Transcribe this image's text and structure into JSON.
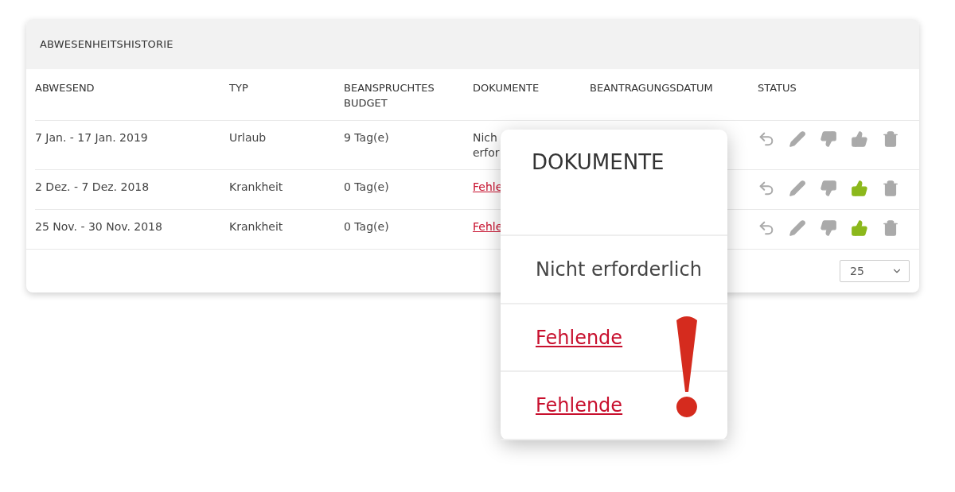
{
  "panel": {
    "title": "ABWESENHEITSHISTORIE",
    "columns": [
      {
        "label": "ABWESEND"
      },
      {
        "label": "TYP"
      },
      {
        "label": "BEANSPRUCHTES BUDGET"
      },
      {
        "label": "DOKUMENTE"
      },
      {
        "label": "BEANTRAGUNGSDATUM"
      },
      {
        "label": "STATUS"
      }
    ],
    "rows": [
      {
        "absent": "7 Jan. - 17 Jan. 2019",
        "type": "Urlaub",
        "budget": "9 Tag(e)",
        "documents": {
          "kind": "text",
          "lines": [
            "Nich",
            "erfor"
          ]
        },
        "approved": false
      },
      {
        "absent": "2 Dez. - 7 Dez. 2018",
        "type": "Krankheit",
        "budget": "0 Tag(e)",
        "documents": {
          "kind": "link",
          "lines": [
            "Fehle"
          ]
        },
        "approved": true
      },
      {
        "absent": "25 Nov. - 30 Nov. 2018",
        "type": "Krankheit",
        "budget": "0 Tag(e)",
        "documents": {
          "kind": "link",
          "lines": [
            "Fehle"
          ]
        },
        "approved": true
      }
    ],
    "page_size": "25"
  },
  "popup": {
    "title": "DOKUMENTE",
    "items": [
      {
        "kind": "text",
        "text": "Nicht erforderlich"
      },
      {
        "kind": "link",
        "text": "Fehlende"
      },
      {
        "kind": "link",
        "text": "Fehlende"
      }
    ]
  }
}
